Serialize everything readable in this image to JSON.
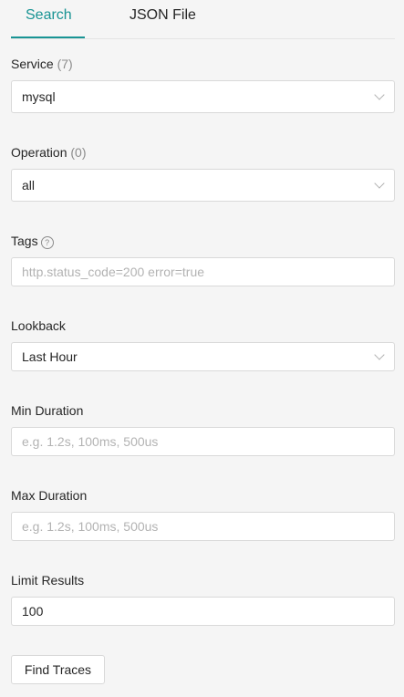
{
  "tabs": [
    {
      "label": "Search",
      "active": true
    },
    {
      "label": "JSON File",
      "active": false
    }
  ],
  "colors": {
    "accent": "#199494",
    "border": "#d9d9d9",
    "background": "#f5f5f5",
    "placeholder": "#b3b3b3"
  },
  "service": {
    "label": "Service",
    "count": "(7)",
    "value": "mysql"
  },
  "operation": {
    "label": "Operation",
    "count": "(0)",
    "value": "all"
  },
  "tags": {
    "label": "Tags",
    "help_glyph": "?",
    "placeholder": "http.status_code=200 error=true"
  },
  "lookback": {
    "label": "Lookback",
    "value": "Last Hour"
  },
  "min_duration": {
    "label": "Min Duration",
    "placeholder": "e.g. 1.2s, 100ms, 500us"
  },
  "max_duration": {
    "label": "Max Duration",
    "placeholder": "e.g. 1.2s, 100ms, 500us"
  },
  "limit_results": {
    "label": "Limit Results",
    "value": "100"
  },
  "find_button": {
    "label": "Find Traces"
  }
}
